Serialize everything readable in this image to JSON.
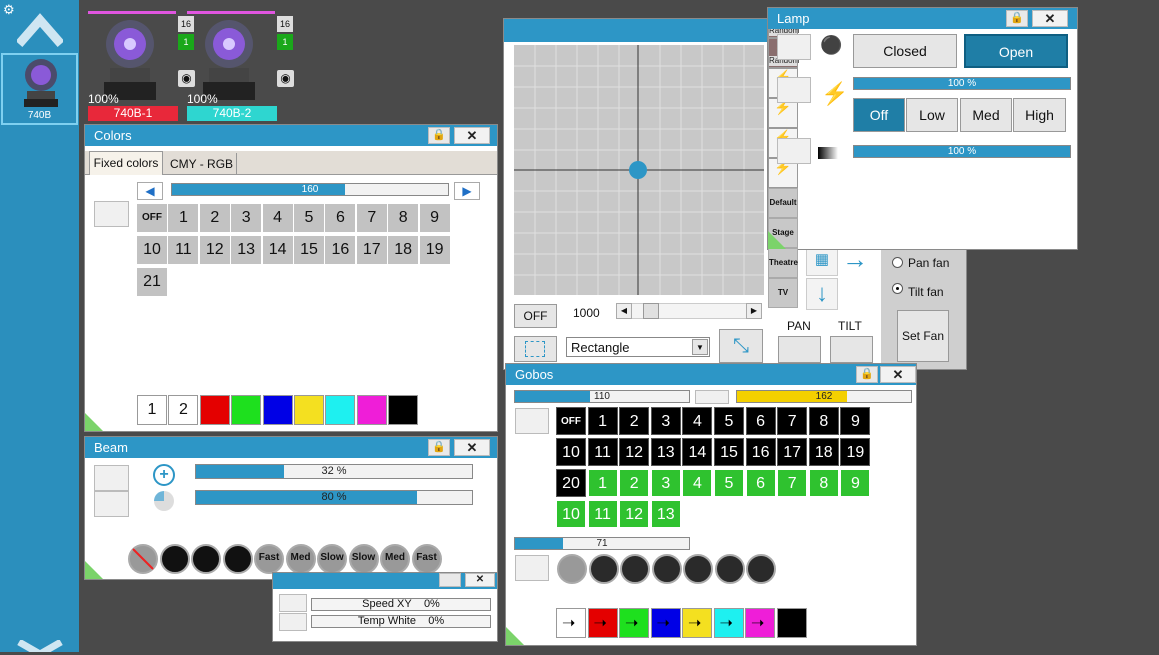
{
  "sidebar": {
    "fixture_label": "740B"
  },
  "fixtures": [
    {
      "percent": "100%",
      "name": "740B-1",
      "color": "#e8283a",
      "top_num": "16",
      "bottom_num": "1"
    },
    {
      "percent": "100%",
      "name": "740B-2",
      "color": "#2ed6d0",
      "top_num": "16",
      "bottom_num": "1"
    }
  ],
  "colors_win": {
    "title": "Colors",
    "tab1": "Fixed colors",
    "tab2": "CMY - RGB",
    "slider_value": "160",
    "cells": [
      "OFF",
      "1",
      "2",
      "3",
      "4",
      "5",
      "6",
      "7",
      "8",
      "9",
      "10",
      "11",
      "12",
      "13",
      "14",
      "15",
      "16",
      "17",
      "18",
      "19",
      "21"
    ],
    "swatch_labels": [
      "1",
      "2"
    ],
    "swatches": [
      "#e40000",
      "#1ee01e",
      "#0000e6",
      "#f4e020",
      "#1ef0f0",
      "#ef1ed8",
      "#000000"
    ]
  },
  "beam_win": {
    "title": "Beam",
    "bar1": "32 %",
    "bar2": "80 %",
    "fx": [
      "Fast",
      "Med",
      "Slow",
      "Slow",
      "Med",
      "Fast"
    ]
  },
  "small_win": {
    "speed": "Speed XY",
    "speed_val": "0%",
    "temp": "Temp White",
    "temp_val": "0%"
  },
  "pantilt": {
    "off": "OFF",
    "speed_value": "1000",
    "shape": "Rectangle",
    "pan": "PAN",
    "tilt": "TILT",
    "pan_fan": "Pan fan",
    "tilt_fan": "Tilt fan",
    "set_fan": "Set Fan"
  },
  "lamp_win": {
    "title": "Lamp",
    "closed": "Closed",
    "open": "Open",
    "bar1": "100 %",
    "bar2": "100 %",
    "off": "Off",
    "low": "Low",
    "med": "Med",
    "high": "High",
    "presets": [
      "Random",
      "Random",
      "",
      "",
      "",
      ""
    ],
    "modes": [
      "Default",
      "Stage",
      "Theatre",
      "TV"
    ]
  },
  "gobos_win": {
    "title": "Gobos",
    "bar1": "110",
    "bar2": "162",
    "bar3": "71",
    "black": [
      "OFF",
      "1",
      "2",
      "3",
      "4",
      "5",
      "6",
      "7",
      "8",
      "9",
      "10",
      "11",
      "12",
      "13",
      "14",
      "15",
      "16",
      "17",
      "18",
      "19",
      "20"
    ],
    "green": [
      "1",
      "2",
      "3",
      "4",
      "5",
      "6",
      "7",
      "8",
      "9",
      "10",
      "11",
      "12",
      "13"
    ],
    "swatches": [
      "#ffffff",
      "#e40000",
      "#1ee01e",
      "#0000e6",
      "#f4e020",
      "#1ef0f0",
      "#ef1ed8",
      "#000000"
    ]
  }
}
